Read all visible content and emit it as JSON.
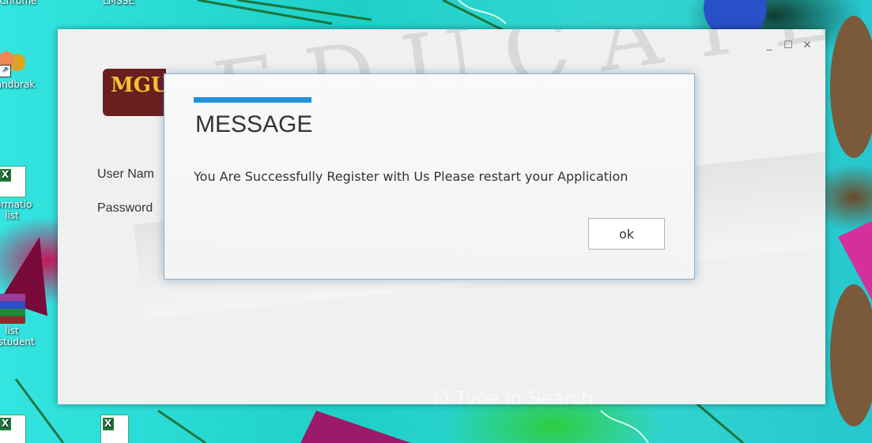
{
  "desktop": {
    "icons": [
      {
        "label": "Chrome"
      },
      {
        "label": "LMSSE"
      },
      {
        "label": "Handbrak"
      },
      {
        "label": "formatio list"
      },
      {
        "label": "list ofstudent"
      }
    ]
  },
  "app": {
    "logo_text": "MGU",
    "username_label": "User Nam",
    "password_label": "Password",
    "watermark_text": "O Type to Search"
  },
  "dialog": {
    "title": "MESSAGE",
    "message": "You Are Successfully Register with Us Please restart your Application",
    "ok_label": "ok",
    "accent_color": "#2392d8"
  },
  "window_controls": {
    "minimize": "_",
    "maximize": "☐",
    "close": "✕"
  }
}
